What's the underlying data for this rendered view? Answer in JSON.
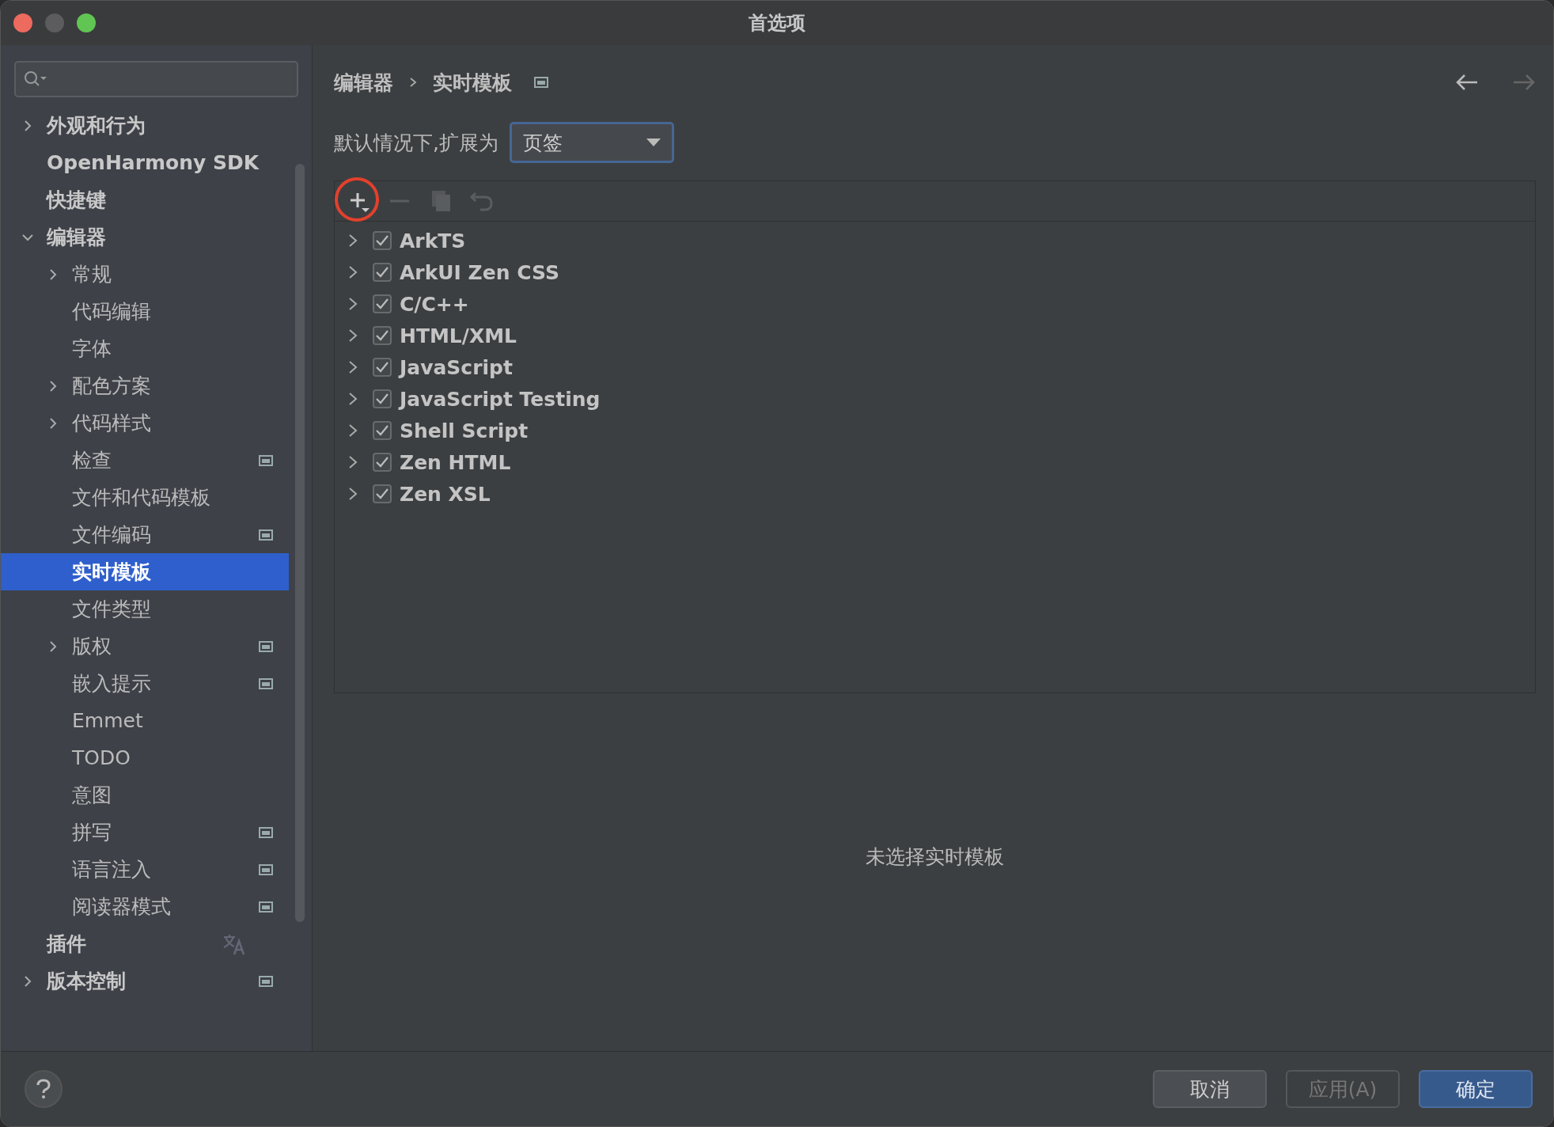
{
  "window": {
    "title": "首选项"
  },
  "sidebar": {
    "items": [
      {
        "label": "外观和行为",
        "expanded": false,
        "selected": false
      },
      {
        "label": "OpenHarmony SDK",
        "selected": false
      },
      {
        "label": "快捷键",
        "selected": false
      },
      {
        "label": "编辑器",
        "expanded": true,
        "selected": false,
        "children": [
          {
            "label": "常规",
            "expanded": false,
            "selected": false
          },
          {
            "label": "代码编辑",
            "selected": false
          },
          {
            "label": "字体",
            "selected": false
          },
          {
            "label": "配色方案",
            "expanded": false,
            "selected": false
          },
          {
            "label": "代码样式",
            "expanded": false,
            "selected": false
          },
          {
            "label": "检查",
            "selected": false,
            "scope_icon": true
          },
          {
            "label": "文件和代码模板",
            "selected": false
          },
          {
            "label": "文件编码",
            "selected": false,
            "scope_icon": true
          },
          {
            "label": "实时模板",
            "selected": true
          },
          {
            "label": "文件类型",
            "selected": false
          },
          {
            "label": "版权",
            "expanded": false,
            "selected": false,
            "scope_icon": true
          },
          {
            "label": "嵌入提示",
            "selected": false,
            "scope_icon": true
          },
          {
            "label": "Emmet",
            "selected": false
          },
          {
            "label": "TODO",
            "selected": false
          },
          {
            "label": "意图",
            "selected": false
          },
          {
            "label": "拼写",
            "selected": false,
            "scope_icon": true
          },
          {
            "label": "语言注入",
            "selected": false,
            "scope_icon": true
          },
          {
            "label": "阅读器模式",
            "selected": false,
            "scope_icon": true
          }
        ]
      },
      {
        "label": "插件",
        "selected": false,
        "translate_icon": true
      },
      {
        "label": "版本控制",
        "expanded": false,
        "selected": false,
        "scope_icon": true
      }
    ]
  },
  "breadcrumb": [
    "编辑器",
    "实时模板"
  ],
  "nav": [
    {
      "kind": "back",
      "disabled": false
    },
    {
      "kind": "forward",
      "disabled": true
    }
  ],
  "expand_setting": {
    "label": "默认情况下,扩展为",
    "value": "页签"
  },
  "toolbar": [
    {
      "kind": "add",
      "disabled": false,
      "highlighted": true
    },
    {
      "kind": "remove",
      "disabled": true,
      "highlighted": false
    },
    {
      "kind": "copy",
      "disabled": true,
      "highlighted": false
    },
    {
      "kind": "revert",
      "disabled": true,
      "highlighted": false
    }
  ],
  "templates": [
    {
      "label": "ArkTS",
      "checked": true,
      "expanded": false
    },
    {
      "label": "ArkUI Zen CSS",
      "checked": true,
      "expanded": false
    },
    {
      "label": "C/C++",
      "checked": true,
      "expanded": false
    },
    {
      "label": "HTML/XML",
      "checked": true,
      "expanded": false
    },
    {
      "label": "JavaScript",
      "checked": true,
      "expanded": false
    },
    {
      "label": "JavaScript Testing",
      "checked": true,
      "expanded": false
    },
    {
      "label": "Shell Script",
      "checked": true,
      "expanded": false
    },
    {
      "label": "Zen HTML",
      "checked": true,
      "expanded": false
    },
    {
      "label": "Zen XSL",
      "checked": true,
      "expanded": false
    }
  ],
  "empty_message": "未选择实时模板",
  "buttons": [
    {
      "label": "取消",
      "kind": "secondary",
      "disabled": false
    },
    {
      "label": "应用(A)",
      "kind": "secondary",
      "disabled": true
    },
    {
      "label": "确定",
      "kind": "primary",
      "disabled": false
    }
  ]
}
